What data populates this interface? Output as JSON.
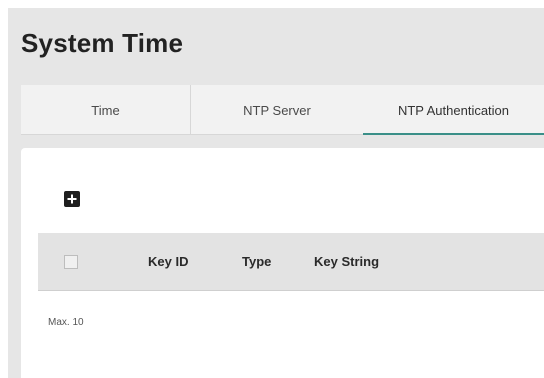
{
  "page": {
    "title": "System Time"
  },
  "tabs": [
    {
      "label": "Time",
      "active": false
    },
    {
      "label": "NTP Server",
      "active": false
    },
    {
      "label": "NTP Authentication",
      "active": true
    }
  ],
  "toolbar": {
    "add_icon": "plus-square-icon"
  },
  "table": {
    "columns": [
      "Key ID",
      "Type",
      "Key String"
    ],
    "rows": [],
    "select_all_checked": false
  },
  "footer": {
    "max_label": "Max. 10"
  },
  "colors": {
    "accent": "#3a8f88",
    "background": "#e6e6e6",
    "header_bg": "#e3e3e3"
  }
}
